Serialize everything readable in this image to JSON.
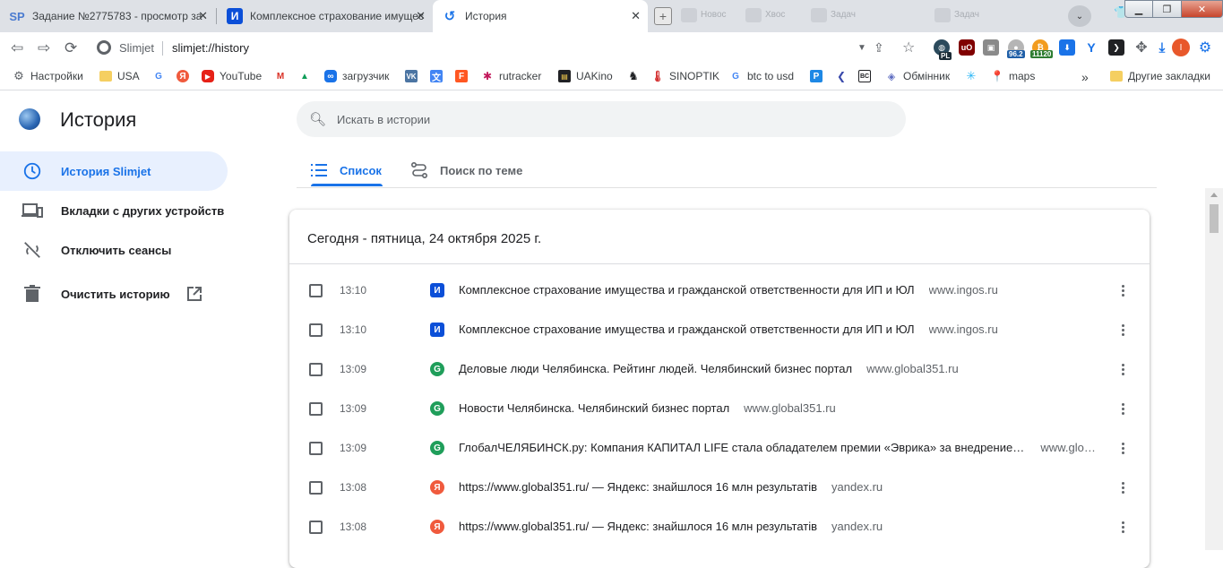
{
  "tabs": [
    {
      "title": "Задание №2775783 - просмотр за",
      "favicon": "SP",
      "active": false
    },
    {
      "title": "Комплексное страхование имущес",
      "favicon": "И",
      "active": false
    },
    {
      "title": "История",
      "favicon": "history-icon",
      "active": true
    }
  ],
  "ghost_tabs": [
    "Новос",
    "Хвос",
    "Задач",
    "Задач"
  ],
  "omnibox": {
    "label": "Slimjet",
    "url": "slimjet://history"
  },
  "extensions": {
    "badge1": "PL",
    "badge2": "96.2",
    "badge3": "11120"
  },
  "avatar_letter": "I",
  "bookmarks": [
    {
      "label": "Настройки",
      "icon": "gear-icon"
    },
    {
      "label": "USA",
      "icon": "folder-icon"
    },
    {
      "label": "",
      "icon": "google-icon"
    },
    {
      "label": "",
      "icon": "yandex-icon"
    },
    {
      "label": "YouTube",
      "icon": "youtube-icon"
    },
    {
      "label": "",
      "icon": "gmail-icon"
    },
    {
      "label": "",
      "icon": "drive-icon"
    },
    {
      "label": "загрузчик",
      "icon": "infinity-icon"
    },
    {
      "label": "",
      "icon": "vk-icon"
    },
    {
      "label": "",
      "icon": "translate-icon"
    },
    {
      "label": "",
      "icon": "f-icon"
    },
    {
      "label": "rutracker",
      "icon": "rutracker-icon"
    },
    {
      "label": "UAKino",
      "icon": "uakino-icon"
    },
    {
      "label": "",
      "icon": "chess-icon"
    },
    {
      "label": "SINOPTIK",
      "icon": "thermometer-icon"
    },
    {
      "label": "btc to usd",
      "icon": "google-icon"
    },
    {
      "label": "",
      "icon": "p-icon"
    },
    {
      "label": "",
      "icon": "arrow-icon"
    },
    {
      "label": "",
      "icon": "bc-icon"
    },
    {
      "label": "Обмінник",
      "icon": "exchange-icon"
    },
    {
      "label": "",
      "icon": "star-burst-icon"
    },
    {
      "label": "maps",
      "icon": "maps-icon"
    }
  ],
  "bookmarks_overflow": "»",
  "other_bookmarks": "Другие закладки",
  "app": {
    "title": "История"
  },
  "search": {
    "placeholder": "Искать в истории"
  },
  "sidebar": [
    {
      "label": "История Slimjet",
      "icon": "clock-icon",
      "active": true
    },
    {
      "label": "Вкладки с других устройств",
      "icon": "devices-icon",
      "active": false
    },
    {
      "label": "Отключить сеансы",
      "icon": "sync-off-icon",
      "active": false
    },
    {
      "label": "Очистить историю",
      "icon": "trash-icon",
      "active": false
    }
  ],
  "page_tabs": [
    {
      "label": "Список",
      "active": true
    },
    {
      "label": "Поиск по теме",
      "active": false
    }
  ],
  "day_header": "Сегодня - пятница, 24 октября 2025 г.",
  "entries": [
    {
      "time": "13:10",
      "favicon": "ingos",
      "title": "Комплексное страхование имущества и гражданской ответственности для ИП и ЮЛ",
      "domain": "www.ingos.ru"
    },
    {
      "time": "13:10",
      "favicon": "ingos",
      "title": "Комплексное страхование имущества и гражданской ответственности для ИП и ЮЛ",
      "domain": "www.ingos.ru"
    },
    {
      "time": "13:09",
      "favicon": "global",
      "title": "Деловые люди Челябинска. Рейтинг людей. Челябинский бизнес портал",
      "domain": "www.global351.ru"
    },
    {
      "time": "13:09",
      "favicon": "global",
      "title": "Новости Челябинска. Челябинский бизнес портал",
      "domain": "www.global351.ru"
    },
    {
      "time": "13:09",
      "favicon": "global",
      "title": "ГлобалЧЕЛЯБИНСК.ру: Компания КАПИТАЛ LIFE стала обладателем премии «Эврика» за внедрение и…",
      "domain": "www.glo…"
    },
    {
      "time": "13:08",
      "favicon": "yandex",
      "title": "https://www.global351.ru/ — Яндекс: знайшлося 16 млн результатів",
      "domain": "yandex.ru"
    },
    {
      "time": "13:08",
      "favicon": "yandex",
      "title": "https://www.global351.ru/ — Яндекс: знайшлося 16 млн результатів",
      "domain": "yandex.ru"
    }
  ],
  "colors": {
    "accent": "#1a73e8",
    "active_bg": "#e8f0fe",
    "ingos": "#0b4fd8",
    "global": "#1f9e5a",
    "yandex": "#f05a3d"
  }
}
